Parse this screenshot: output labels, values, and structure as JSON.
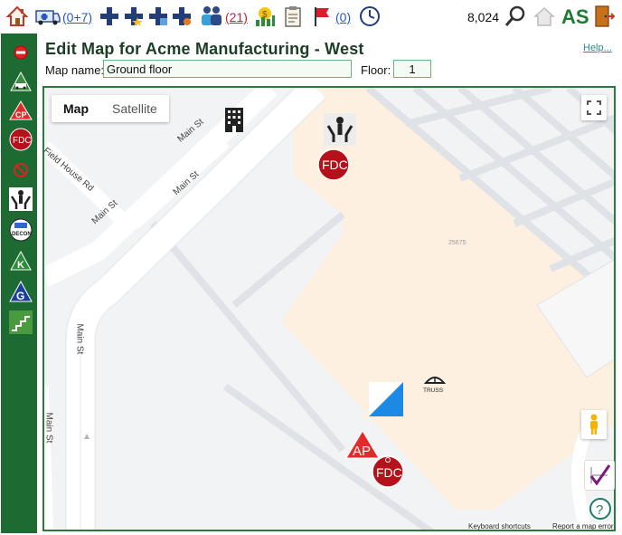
{
  "toolbar": {
    "home_icon": "home-icon",
    "ambulance_count": "(0+7)",
    "people_count": "(21)",
    "flag_count": "(0)",
    "number": "8,024",
    "user_initials": "AS"
  },
  "sidebar": {
    "items": [
      "no-entry-icon",
      "vehicle-icon",
      "command-post-icon",
      "fdc-icon",
      "no-smoking-icon",
      "rescue-icon",
      "decon-icon",
      "knox-box-icon",
      "gas-shutoff-icon",
      "stairs-icon"
    ],
    "cp_label": "CP",
    "fdc_label": "FDC",
    "decon_label": "DECON",
    "k_label": "K",
    "g_label": "G"
  },
  "page": {
    "title": "Edit Map for Acme Manufacturing - West",
    "help_link": "Help...",
    "map_name_label": "Map name:",
    "map_name_value": "Ground floor",
    "floor_label": "Floor:",
    "floor_value": "1"
  },
  "map": {
    "tabs": [
      {
        "label": "Map",
        "active": true
      },
      {
        "label": "Satellite",
        "active": false
      }
    ],
    "streets": [
      "Main St",
      "Main St",
      "Field House Rd",
      "Main St",
      "Main St",
      "Main St"
    ],
    "building_number": "25675",
    "markers": {
      "fdc_label": "FDC",
      "ap_label": "AP",
      "truss_label": "TRUSS"
    },
    "footer": {
      "shortcuts": "Keyboard shortcuts",
      "report": "Report a map error"
    }
  },
  "colors": {
    "accent": "#1d6b33",
    "building": "#fdf0e0",
    "marker_red": "#b5111b"
  }
}
